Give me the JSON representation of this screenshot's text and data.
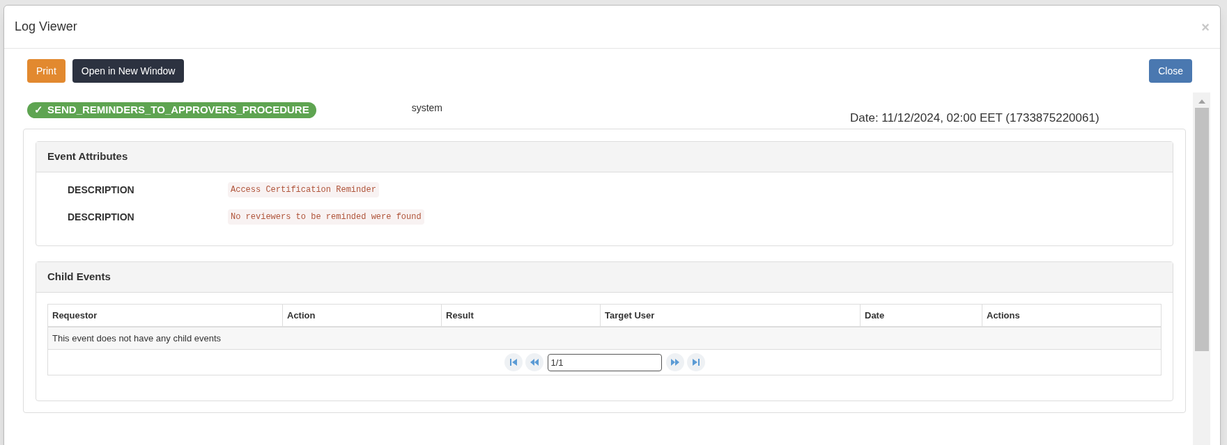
{
  "dialog": {
    "title": "Log Viewer",
    "close_glyph": "×"
  },
  "toolbar": {
    "buttons": [
      {
        "label": "Print",
        "kind": "warning"
      },
      {
        "label": "Open in New Window",
        "kind": "dark"
      }
    ],
    "close": "Close"
  },
  "event": {
    "status_glyph": "✓",
    "name": "SEND_REMINDERS_TO_APPROVERS_PROCEDURE",
    "success": true,
    "user": "system",
    "date": "Date: 11/12/2024, 02:00 EET (1733875220061)"
  },
  "attributes": {
    "title": "Event Attributes",
    "rows": [
      {
        "label": "DESCRIPTION",
        "value": "Access Certification Reminder"
      },
      {
        "label": "DESCRIPTION",
        "value": "No reviewers to be reminded were found"
      }
    ]
  },
  "child_events": {
    "title": "Child Events",
    "columns": [
      "Requestor",
      "Action",
      "Result",
      "Target User",
      "Date",
      "Actions"
    ],
    "empty_message": "This event does not have any child events",
    "pager": {
      "page": "1/1"
    }
  }
}
